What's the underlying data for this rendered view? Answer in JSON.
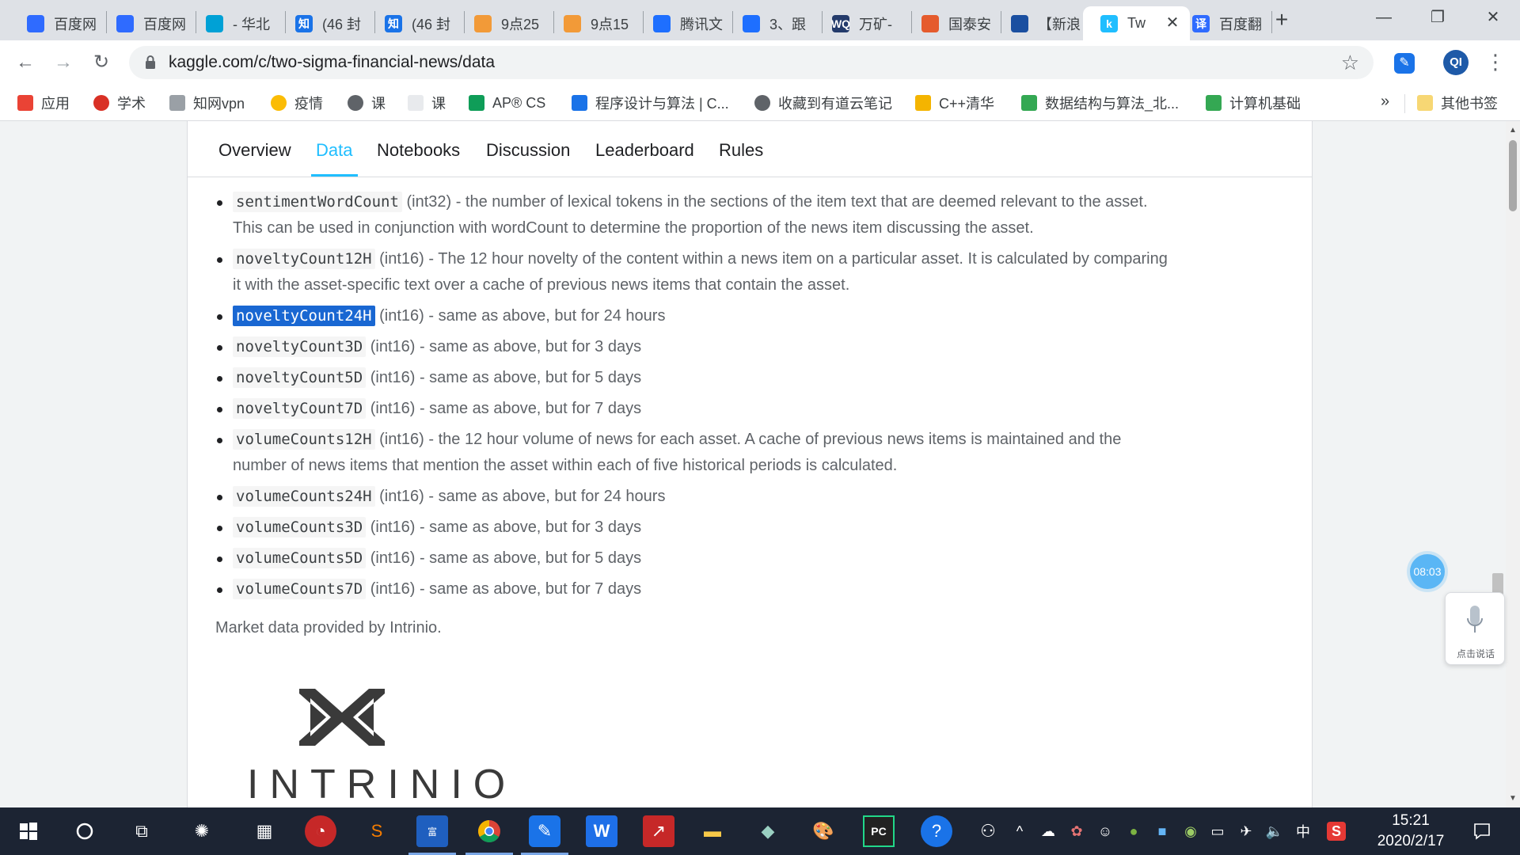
{
  "browser": {
    "tabs": [
      {
        "title": "百度网",
        "fav_color": "#2f6bff",
        "fav_icon": "baidu-pan-icon"
      },
      {
        "title": "百度网",
        "fav_color": "#2f6bff",
        "fav_icon": "baidu-pan-icon"
      },
      {
        "title": "- 华北",
        "fav_color": "#00a1d6",
        "fav_icon": "bilibili-icon"
      },
      {
        "title": "(46 封",
        "fav_color": "#1a73e8",
        "fav_icon": "zhihu-icon",
        "glyph": "知"
      },
      {
        "title": "(46 封",
        "fav_color": "#1a73e8",
        "fav_icon": "zhihu-icon",
        "glyph": "知"
      },
      {
        "title": "9点25",
        "fav_color": "#f29a38",
        "fav_icon": "weibo-icon"
      },
      {
        "title": "9点15",
        "fav_color": "#f29a38",
        "fav_icon": "weibo-icon"
      },
      {
        "title": "腾讯文",
        "fav_color": "#1e6fff",
        "fav_icon": "tencent-docs-icon"
      },
      {
        "title": "3、跟",
        "fav_color": "#1e6fff",
        "fav_icon": "document-icon"
      },
      {
        "title": "万矿-",
        "fav_color": "#243b6b",
        "fav_icon": "wq-icon",
        "glyph": "WQ"
      },
      {
        "title": "国泰安",
        "fav_color": "#e55b2d",
        "fav_icon": "flag-icon"
      },
      {
        "title": "【新浪",
        "fav_color": "#1a4fa0",
        "fav_icon": "chart-icon"
      },
      {
        "title": "Tw",
        "fav_color": "#20beff",
        "fav_icon": "kaggle-icon",
        "glyph": "k",
        "active": true
      },
      {
        "title": "百度翻",
        "fav_color": "#2f6bff",
        "fav_icon": "baidu-translate-icon",
        "glyph": "译"
      }
    ],
    "close_tab_glyph": "✕",
    "new_tab_glyph": "+",
    "window_controls": {
      "minimize": "—",
      "restore": "❐",
      "close": "✕"
    },
    "url": "kaggle.com/c/two-sigma-financial-news/data",
    "profile_initials": "QI",
    "bookmarks": [
      {
        "label": "应用",
        "color": "#ea4335",
        "icon": "apps-grid-icon"
      },
      {
        "label": "学术",
        "color": "#d93025",
        "icon": "academic-icon"
      },
      {
        "label": "知网vpn",
        "color": "#9aa0a6",
        "icon": "cnki-icon"
      },
      {
        "label": "疫情",
        "color": "#fbbc05",
        "icon": "chrome-icon"
      },
      {
        "label": "课",
        "color": "#5f6368",
        "icon": "globe-icon"
      },
      {
        "label": "课",
        "color": "#e8eaed",
        "icon": "page-icon"
      },
      {
        "label": "AP® CS",
        "color": "#0f9d58",
        "icon": "ap-shield-icon"
      },
      {
        "label": "程序设计与算法 | C...",
        "color": "#1a73e8",
        "icon": "coursera-icon"
      },
      {
        "label": "收藏到有道云笔记",
        "color": "#5f6368",
        "icon": "globe-icon"
      },
      {
        "label": "C++清华",
        "color": "#f4b400",
        "icon": "tsinghua-icon"
      },
      {
        "label": "数据结构与算法_北...",
        "color": "#34a853",
        "icon": "mooc-icon"
      },
      {
        "label": "计算机基础",
        "color": "#34a853",
        "icon": "mooc-icon"
      }
    ],
    "bookmarks_more": "»",
    "other_bookmarks": "其他书签"
  },
  "kaggle": {
    "tabs": [
      "Overview",
      "Data",
      "Notebooks",
      "Discussion",
      "Leaderboard",
      "Rules"
    ],
    "active_tab": "Data",
    "items": [
      {
        "code": "sentimentWordCount",
        "desc": " (int32) - the number of lexical tokens in the sections of the item text that are deemed relevant to the asset.",
        "desc2": "This can be used in conjunction with wordCount to determine the proportion of the news item discussing the asset."
      },
      {
        "code": "noveltyCount12H",
        "desc": " (int16) - The 12 hour novelty of the content within a news item on a particular asset. It is calculated by comparing",
        "desc2": "it with the asset-specific text over a cache of previous news items that contain the asset."
      },
      {
        "code": "noveltyCount24H",
        "desc": " (int16) - same as above, but for 24 hours",
        "selected": true
      },
      {
        "code": "noveltyCount3D",
        "desc": " (int16) - same as above, but for 3 days"
      },
      {
        "code": "noveltyCount5D",
        "desc": " (int16) - same as above, but for 5 days"
      },
      {
        "code": "noveltyCount7D",
        "desc": " (int16) - same as above, but for 7 days"
      },
      {
        "code": "volumeCounts12H",
        "desc": " (int16) - the 12 hour volume of news for each asset. A cache of previous news items is maintained and the",
        "desc2": "number of news items that mention the asset within each of five historical periods is calculated."
      },
      {
        "code": "volumeCounts24H",
        "desc": " (int16) - same as above, but for 24 hours"
      },
      {
        "code": "volumeCounts3D",
        "desc": " (int16) - same as above, but for 3 days"
      },
      {
        "code": "volumeCounts5D",
        "desc": " (int16) - same as above, but for 5 days"
      },
      {
        "code": "volumeCounts7D",
        "desc": " (int16) - same as above, but for 7 days"
      }
    ],
    "market_text": "Market data provided by Intrinio.",
    "logo_text": "INTRINIO"
  },
  "widget": {
    "timer": "08:03",
    "voice_label": "点击说话"
  },
  "taskbar": {
    "time": "15:21",
    "date": "2020/2/17",
    "ime": "中"
  },
  "colors": {
    "kaggle_accent": "#20beff",
    "selection": "#1967d2",
    "taskbar_bg": "#1c2433"
  }
}
